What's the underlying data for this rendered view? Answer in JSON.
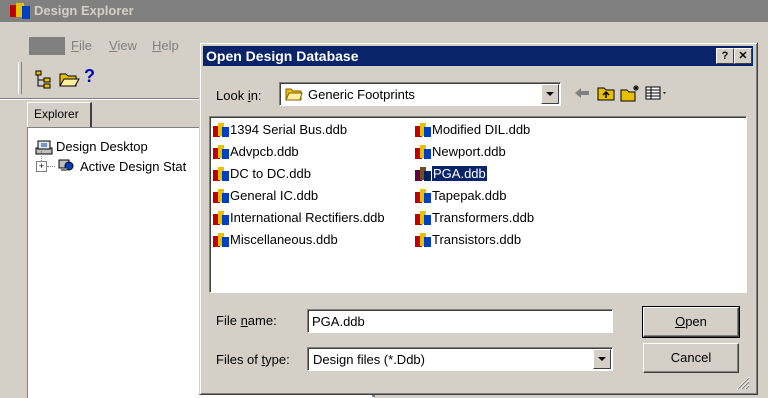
{
  "background_window": {
    "title": "Design Explorer",
    "menu": [
      {
        "label_rest": "ile",
        "accel": "F"
      },
      {
        "label_rest": "iew",
        "accel": "V"
      },
      {
        "label_rest": "elp",
        "accel": "H"
      }
    ],
    "tab_label": "Explorer",
    "tree": {
      "root_label": "Design Desktop",
      "child_label": "Active Design Stat"
    }
  },
  "dialog": {
    "title": "Open Design Database",
    "help_button": "?",
    "close_button": "✕",
    "look_in_label_pre": "Look ",
    "look_in_label_accel": "i",
    "look_in_label_post": "n:",
    "look_in_value": "Generic Footprints",
    "files": [
      "1394 Serial Bus.ddb",
      "Advpcb.ddb",
      "DC to DC.ddb",
      "General IC.ddb",
      "International Rectifiers.ddb",
      "Miscellaneous.ddb",
      "Modified DIL.ddb",
      "Newport.ddb",
      "PGA.ddb",
      "Tapepak.ddb",
      "Transformers.ddb",
      "Transistors.ddb"
    ],
    "selected_file": "PGA.ddb",
    "file_name_label_pre": "File ",
    "file_name_label_accel": "n",
    "file_name_label_post": "ame:",
    "file_name_value": "PGA.ddb",
    "files_of_type_label_pre": "Files of ",
    "files_of_type_label_accel": "t",
    "files_of_type_label_post": "ype:",
    "files_of_type_value": "Design files (*.Ddb)",
    "open_button_accel": "O",
    "open_button_rest": "pen",
    "cancel_button": "Cancel"
  },
  "colors": {
    "titlebar_active": "#0a246a",
    "titlebar_inactive": "#808080",
    "face": "#d4d0c8"
  }
}
